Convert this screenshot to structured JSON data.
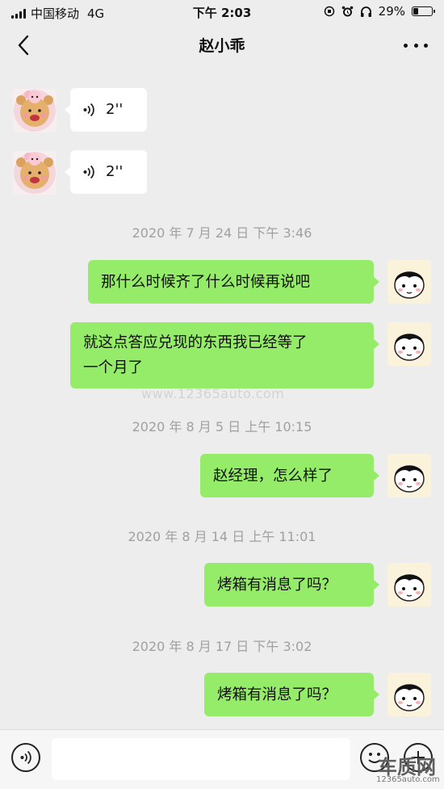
{
  "status_bar": {
    "carrier": "中国移动",
    "network": "4G",
    "time": "下午 2:03",
    "battery_text": "29%",
    "battery_level": 0.29
  },
  "nav": {
    "title": "赵小乖",
    "back_icon": "chevron-left-icon",
    "more_icon": "more-dots-icon"
  },
  "messages": [
    {
      "side": "left",
      "type": "voice",
      "duration": "2''"
    },
    {
      "side": "left",
      "type": "voice",
      "duration": "2''"
    },
    {
      "type": "time",
      "text": "2020 年 7 月 24 日  下午 3:46"
    },
    {
      "side": "right",
      "type": "text",
      "text": "那什么时候齐了什么时候再说吧"
    },
    {
      "side": "right",
      "type": "text",
      "line1": "就这点答应兑现的东西我已经等了",
      "line2": "一个月了"
    },
    {
      "type": "time",
      "text": "2020 年 8 月 5 日  上午 10:15"
    },
    {
      "side": "right",
      "type": "text",
      "text": "赵经理，怎么样了"
    },
    {
      "type": "time",
      "text": "2020 年 8 月 14 日  上午 11:01"
    },
    {
      "side": "right",
      "type": "text",
      "text": "烤箱有消息了吗？"
    },
    {
      "type": "time",
      "text": "2020 年 8 月 17 日  下午 3:02"
    },
    {
      "side": "right",
      "type": "text",
      "text": "烤箱有消息了吗？"
    }
  ],
  "watermark": "www.12365auto.com",
  "site_logo": {
    "text": "车质网",
    "url": "12365auto.com"
  },
  "colors": {
    "background": "#ededed",
    "bubble_right": "#95ec69",
    "bubble_left": "#ffffff",
    "timestamp": "#a0a0a0"
  }
}
